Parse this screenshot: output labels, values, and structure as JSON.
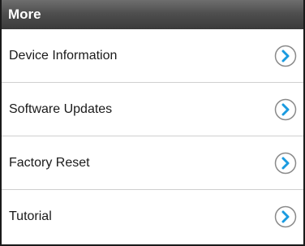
{
  "header": {
    "title": "More"
  },
  "menu": {
    "items": [
      {
        "label": "Device Information",
        "icon": "chevron-right-circle-icon"
      },
      {
        "label": "Software Updates",
        "icon": "chevron-right-circle-icon"
      },
      {
        "label": "Factory Reset",
        "icon": "chevron-right-circle-icon"
      },
      {
        "label": "Tutorial",
        "icon": "chevron-right-circle-icon"
      }
    ]
  },
  "colors": {
    "accent": "#1a9be0",
    "header_top": "#6e6e6e",
    "header_bottom": "#3a3a3a",
    "divider": "#cfcfcf"
  }
}
